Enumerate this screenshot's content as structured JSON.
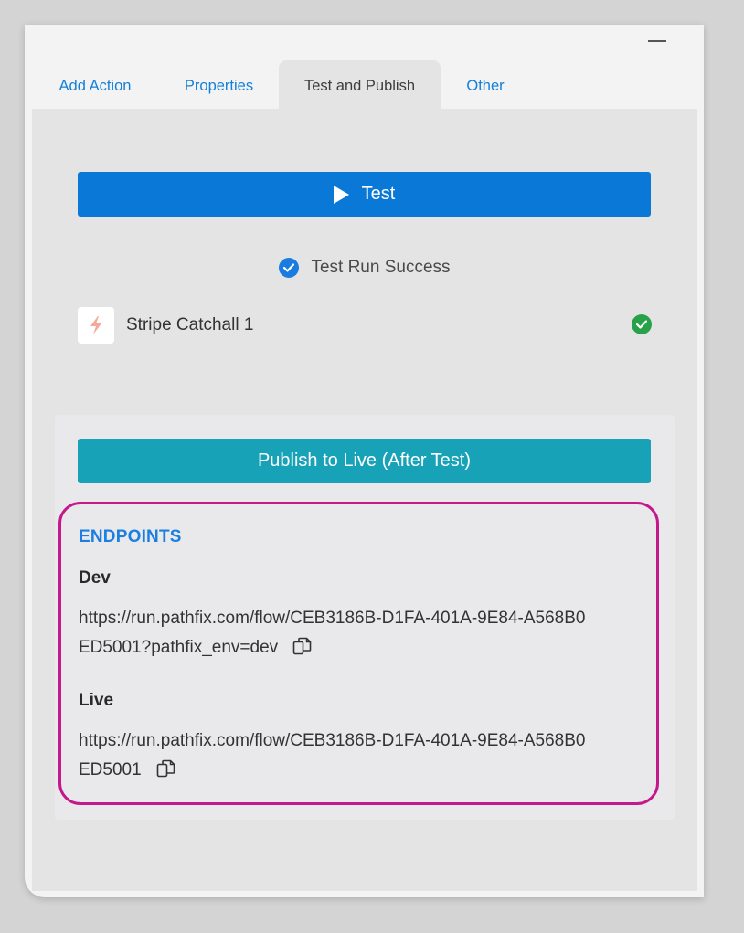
{
  "window": {
    "minimize_label": "minimize"
  },
  "tabs": [
    {
      "label": "Add Action",
      "active": false
    },
    {
      "label": "Properties",
      "active": false
    },
    {
      "label": "Test and Publish",
      "active": true
    },
    {
      "label": "Other",
      "active": false
    }
  ],
  "test_button": {
    "label": "Test",
    "icon": "play-icon"
  },
  "run_status": {
    "text": "Test Run Success",
    "icon": "check-circle-icon"
  },
  "step": {
    "label": "Stripe Catchall 1",
    "icon": "lightning-icon",
    "status_icon": "success-check-icon"
  },
  "publish": {
    "button_label": "Publish to Live (After Test)",
    "endpoints_heading": "ENDPOINTS",
    "dev_label": "Dev",
    "dev_url": "https://run.pathfix.com/flow/CEB3186B-D1FA-401A-9E84-A568B0ED5001?pathfix_env=dev",
    "live_label": "Live",
    "live_url": "https://run.pathfix.com/flow/CEB3186B-D1FA-401A-9E84-A568B0ED5001"
  },
  "colors": {
    "accent_blue": "#0a78d6",
    "teal": "#17a2b8",
    "success_green": "#27a24a",
    "highlight_magenta": "#c5198b"
  }
}
